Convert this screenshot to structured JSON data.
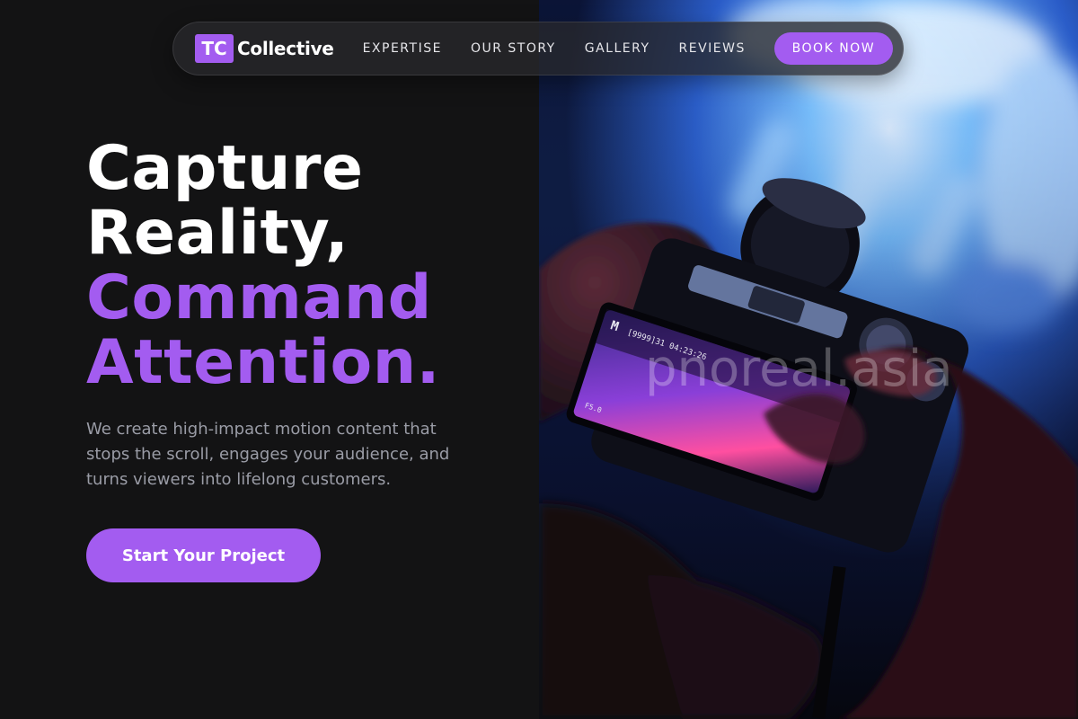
{
  "brand": {
    "mark": "TC",
    "name": "Collective",
    "accent_color": "#a35cf0"
  },
  "nav": {
    "links": [
      "EXPERTISE",
      "OUR STORY",
      "GALLERY",
      "REVIEWS"
    ],
    "cta_label": "BOOK NOW"
  },
  "hero": {
    "headline_line1": "Capture",
    "headline_line2": "Reality,",
    "headline_line3": "Command",
    "headline_line4": "Attention.",
    "subtext": "We create high-impact motion content that stops the scroll, engages your audience, and turns viewers into lifelong customers.",
    "cta_label": "Start Your Project"
  },
  "image": {
    "watermark": "pnoreal.asia",
    "camera_screen_mode": "M",
    "camera_screen_info": "[9999]31  04:23:26",
    "camera_screen_aperture": "F5.0"
  }
}
